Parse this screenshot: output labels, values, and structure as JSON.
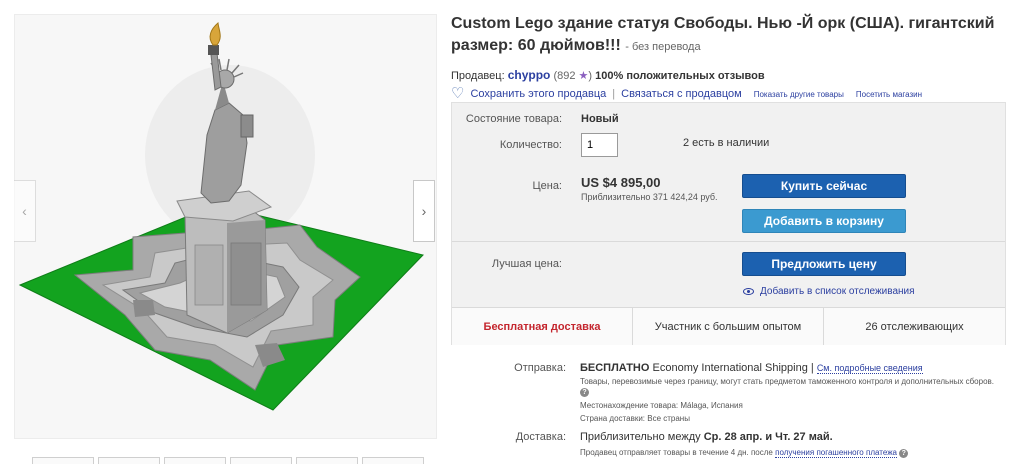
{
  "listing": {
    "title": "Custom Lego здание статуя Свободы. Нью -Й орк (США). гигантский размер: 60 дюймов!!!",
    "title_suffix": "- без перевода"
  },
  "seller": {
    "label": "Продавец:",
    "name": "chyppo",
    "feedback_score": "(892",
    "feedback_close": ")",
    "star_icon": "purple-star-icon",
    "positive": "100% положительных отзывов",
    "save": "Сохранить этого продавца",
    "separator": "|",
    "contact": "Связаться с продавцом",
    "other_items": "Показать другие товары",
    "visit_store": "Посетить магазин"
  },
  "buybox": {
    "condition_label": "Состояние товара:",
    "condition_value": "Новый",
    "quantity_label": "Количество:",
    "quantity_value": "1",
    "available": "2 есть в наличии",
    "price_label": "Цена:",
    "price": "US $4 895,00",
    "price_approx": "Приблизительно 371 424,24 руб.",
    "buy_now": "Купить сейчас",
    "add_to_cart": "Добавить в корзину",
    "best_offer_label": "Лучшая цена:",
    "make_offer": "Предложить цену",
    "watch": "Добавить в список отслеживания",
    "free_shipping": "Бесплатная доставка",
    "top_seller": "Участник с большим опытом",
    "watchers": "26 отслеживающих"
  },
  "shipping": {
    "label": "Отправка:",
    "free": "БЕСПЛАТНО",
    "service": "Economy International Shipping |",
    "details_link": "См. подробные сведения",
    "customs_note": "Товары, перевозимые через границу, могут стать предметом таможенного контроля и дополнительных сборов.",
    "location": "Местонахождение товара: Málaga, Испания",
    "countries": "Страна доставки: Все страны",
    "delivery_label": "Доставка:",
    "delivery_text": "Приблизительно между",
    "delivery_dates": "Ср. 28 апр. и Чт. 27 май.",
    "handling_note": "Продавец отправляет товары в течение 4 дн. после",
    "payment_link": "получения погашенного платежа"
  },
  "colors": {
    "brand_blue": "#1c61b0",
    "cart_blue": "#3b9ad0",
    "link_blue": "#2b3fa0",
    "free_red": "#c4262e",
    "baseplate_green": "#13a31f"
  }
}
